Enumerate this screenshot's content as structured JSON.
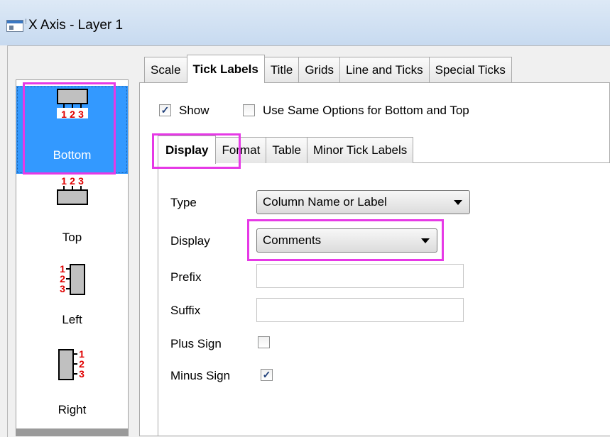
{
  "window": {
    "title": "X Axis - Layer 1"
  },
  "sidebar": {
    "items": [
      {
        "label": "Bottom",
        "selected": true,
        "icon": "bottom-axis-icon"
      },
      {
        "label": "Top",
        "selected": false,
        "icon": "top-axis-icon"
      },
      {
        "label": "Left",
        "selected": false,
        "icon": "left-axis-icon"
      },
      {
        "label": "Right",
        "selected": false,
        "icon": "right-axis-icon"
      }
    ],
    "icon_numbers": [
      "1",
      "2",
      "3"
    ]
  },
  "top_tabs": [
    {
      "label": "Scale",
      "active": false
    },
    {
      "label": "Tick Labels",
      "active": true
    },
    {
      "label": "Title",
      "active": false
    },
    {
      "label": "Grids",
      "active": false
    },
    {
      "label": "Line and Ticks",
      "active": false
    },
    {
      "label": "Special Ticks",
      "active": false
    }
  ],
  "options": {
    "show": {
      "label": "Show",
      "checked": true
    },
    "same_options": {
      "label": "Use Same Options for Bottom and Top",
      "checked": false
    }
  },
  "inner_tabs": [
    {
      "label": "Display",
      "active": true
    },
    {
      "label": "Format",
      "active": false
    },
    {
      "label": "Table",
      "active": false
    },
    {
      "label": "Minor Tick Labels",
      "active": false
    }
  ],
  "form": {
    "type": {
      "label": "Type",
      "value": "Column Name or Label"
    },
    "display": {
      "label": "Display",
      "value": "Comments"
    },
    "prefix": {
      "label": "Prefix",
      "value": ""
    },
    "suffix": {
      "label": "Suffix",
      "value": ""
    },
    "plus_sign": {
      "label": "Plus Sign",
      "checked": false
    },
    "minus_sign": {
      "label": "Minus Sign",
      "checked": true
    }
  },
  "colors": {
    "highlight": "#e639e6",
    "selection": "#3399ff",
    "icon_numbers": "#e00000"
  }
}
